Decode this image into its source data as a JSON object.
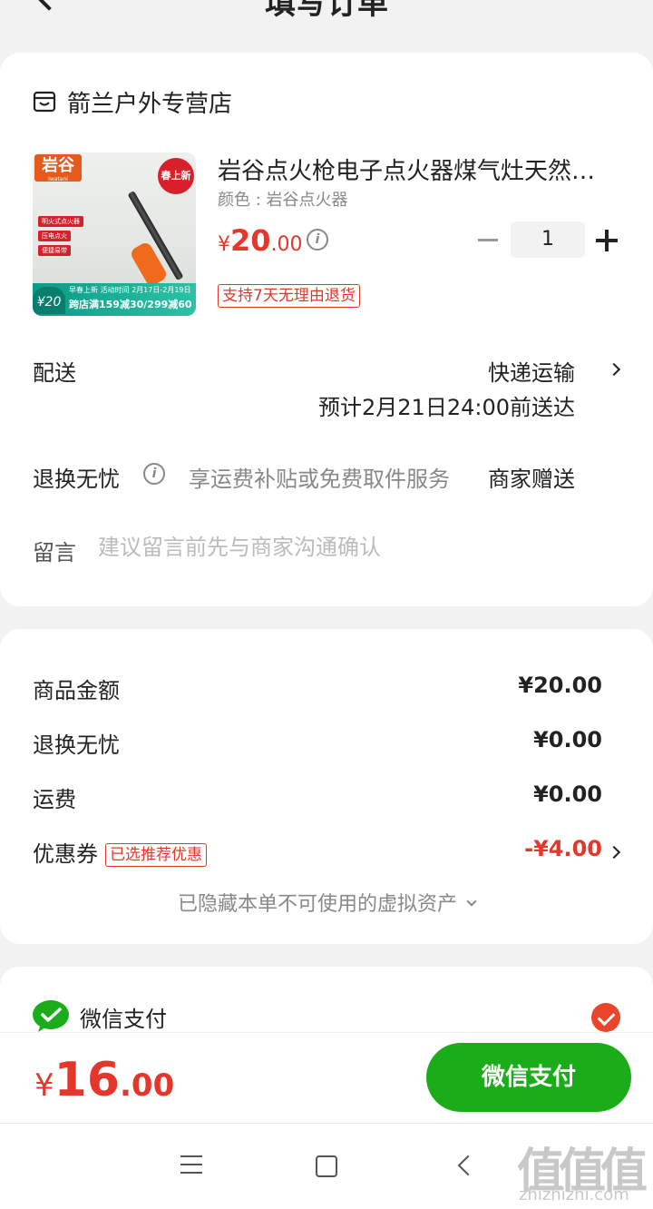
{
  "header": {
    "title": "填写订单"
  },
  "store": {
    "name": "箭兰户外专营店"
  },
  "product": {
    "image_brand": "岩谷",
    "image_brand_sub": "Iwatani",
    "image_badge": "春上新",
    "image_features": [
      "明火式点火器",
      "压电点火",
      "便捷易带"
    ],
    "image_promo_price": "¥20",
    "image_promo_line1": "早春上新 活动时间 2月17日-2月19日",
    "image_promo_line2": "跨店满159减30/299减60",
    "title": "岩谷点火枪电子点火器煤气灶天然燃气",
    "spec": "颜色 : 岩谷点火器",
    "price_currency": "¥",
    "price_int": "20",
    "price_dec": ".00",
    "quantity": "1",
    "return_tag": "支持7天无理由退货"
  },
  "delivery": {
    "label": "配送",
    "method": "快递运输",
    "eta": "预计2月21日24:00前送达"
  },
  "worry_free": {
    "label": "退换无忧",
    "desc": "享运费补贴或免费取件服务",
    "value": "商家赠送"
  },
  "message": {
    "label": "留言",
    "placeholder": "建议留言前先与商家沟通确认",
    "value": ""
  },
  "summary": {
    "goods_label": "商品金额",
    "goods_value": "¥20.00",
    "worry_label": "退换无忧",
    "worry_value": "¥0.00",
    "shipping_label": "运费",
    "shipping_value": "¥0.00",
    "coupon_label": "优惠券",
    "coupon_tag": "已选推荐优惠",
    "coupon_value": "-¥4.00",
    "hidden_assets": "已隐藏本单不可使用的虚拟资产"
  },
  "payment": {
    "method": "微信支付",
    "selected": true
  },
  "paybar": {
    "total_currency": "¥",
    "total_int": "16",
    "total_dec": ".00",
    "pay_button": "微信支付"
  },
  "watermark": {
    "glyphs": "值值值",
    "url": "zhizhizhi.com"
  },
  "colors": {
    "accent_red": "#e4362a",
    "wechat_green": "#1aad19",
    "check_red": "#e9452a"
  }
}
